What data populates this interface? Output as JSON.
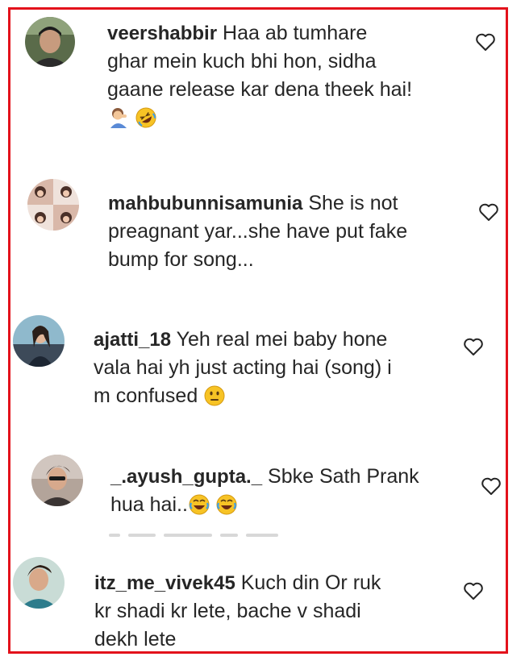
{
  "comments": [
    {
      "username": "veershabbir",
      "text_lines": [
        "Haa ab tumhare",
        "ghar mein kuch bhi hon, sidha",
        "gaane release kar dena theek hai!"
      ],
      "emojis": [
        "person-facepalming-emoji",
        "rolling-on-floor-laughing-emoji"
      ],
      "like_icon": "heart-outline-icon"
    },
    {
      "username": "mahbubunnisamunia",
      "text_lines": [
        "She is not",
        "preagnant yar...she have put fake",
        "bump for song..."
      ],
      "emojis": [],
      "like_icon": "heart-outline-icon"
    },
    {
      "username": "ajatti_18",
      "text_lines": [
        "Yeh real mei baby hone",
        "vala hai yh just acting hai (song) i",
        "m confused"
      ],
      "emojis": [
        "neutral-face-emoji"
      ],
      "like_icon": "heart-outline-icon"
    },
    {
      "username": "_.ayush_gupta._",
      "text_lines": [
        "Sbke Sath Prank",
        "hua hai.."
      ],
      "emojis": [
        "face-with-tears-of-joy-emoji",
        "face-with-tears-of-joy-emoji"
      ],
      "like_icon": "heart-outline-icon"
    },
    {
      "username": "itz_me_vivek45",
      "text_lines": [
        "Kuch din Or ruk",
        "kr shadi kr lete, bache v shadi",
        "dekh lete"
      ],
      "emojis": [],
      "like_icon": "heart-outline-icon"
    }
  ],
  "colors": {
    "frame_border": "#e3121b",
    "text": "#262626",
    "heart_stroke": "#262626",
    "emoji_yellow": "#f7c325"
  }
}
